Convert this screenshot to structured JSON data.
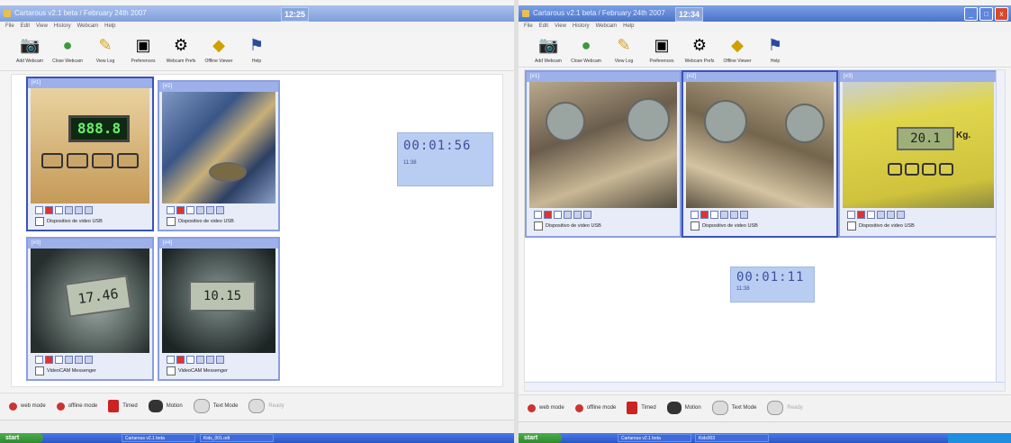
{
  "app": {
    "left_title": "Cartarous v2.1 beta / February 24th 2007",
    "right_title": "Cartarous v2.1 beta / February 24th 2007",
    "left_clock": "12:25",
    "right_clock": "12:34",
    "window_buttons": [
      "_",
      "□",
      "x"
    ]
  },
  "menu": [
    "File",
    "Edit",
    "View",
    "History",
    "Webcam",
    "Help"
  ],
  "toolbar": [
    {
      "label": "Add Webcam",
      "icon": "add-webcam-icon"
    },
    {
      "label": "Close Webcam",
      "icon": "close-webcam-icon"
    },
    {
      "label": "View Log",
      "icon": "view-log-icon"
    },
    {
      "label": "Preferences",
      "icon": "preferences-icon"
    },
    {
      "label": "Webcam Prefs",
      "icon": "webcam-prefs-icon"
    },
    {
      "label": "Offline Viewer",
      "icon": "offline-viewer-icon"
    },
    {
      "label": "Help",
      "icon": "help-icon"
    }
  ],
  "left_cams": [
    {
      "title": "[#1]",
      "device": "Dispositivo de video USB",
      "reading": "888.8"
    },
    {
      "title": "[#2]",
      "device": "Dispositivo de video USB"
    },
    {
      "title": "[#3]",
      "device": "VideoCAM Messenger",
      "reading": "17.46"
    },
    {
      "title": "[#4]",
      "device": "VideoCAM Messenger",
      "reading": "10.15"
    }
  ],
  "right_cams": [
    {
      "title": "[#1]",
      "device": "Dispositivo de video USB"
    },
    {
      "title": "[#2]",
      "device": "Dispositivo de video USB"
    },
    {
      "title": "[#3]",
      "device": "Dispositivo de video USB",
      "reading": "20.1",
      "unit": "Kg."
    }
  ],
  "left_timer": {
    "time": "00:01:56",
    "sub": "11:38"
  },
  "right_timer": {
    "time": "00:01:11",
    "sub": "11:38"
  },
  "bottom_bar": [
    {
      "label": "web mode",
      "icon": "web-mode-icon"
    },
    {
      "label": "offline mode",
      "icon": "offline-mode-icon"
    },
    {
      "label": "Timed",
      "icon": "timed-icon"
    },
    {
      "label": "Motion",
      "icon": "motion-icon"
    },
    {
      "label": "Text Mode",
      "icon": "text-mode-icon"
    },
    {
      "label": "Ready",
      "icon": "ready-icon"
    }
  ],
  "taskbar": {
    "start": "start",
    "left_tasks": [
      "Cartarous v2.1 beta",
      "Kids_001.odt"
    ],
    "right_tasks": [
      "Cartarous v2.1 beta",
      "Kids003"
    ]
  },
  "colors": {
    "accent": "#4a73c9",
    "panel": "#e7ecf8",
    "timer_bg": "#b9cdf2"
  }
}
